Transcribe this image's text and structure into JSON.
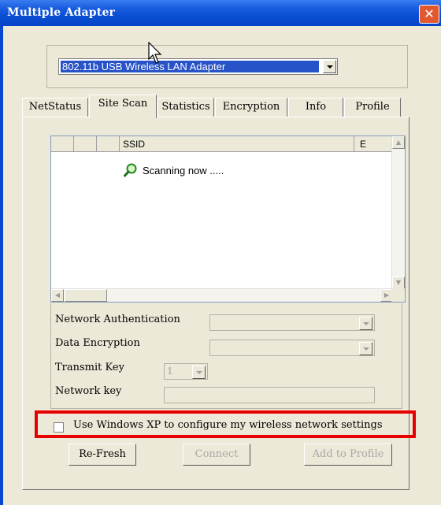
{
  "window": {
    "title": "Multiple Adapter",
    "close_glyph": "✕"
  },
  "adapter": {
    "selected": "802.11b USB Wireless LAN Adapter"
  },
  "tabs": [
    {
      "label": "NetStatus",
      "active": false
    },
    {
      "label": "Site Scan",
      "active": true
    },
    {
      "label": "Statistics",
      "active": false
    },
    {
      "label": "Encryption",
      "active": false
    },
    {
      "label": "Info",
      "active": false
    },
    {
      "label": "Profile",
      "active": false
    }
  ],
  "site_scan": {
    "columns": [
      "",
      "",
      "",
      "SSID",
      "E"
    ],
    "status": "Scanning now .....",
    "status_icon": "search-icon"
  },
  "settings": {
    "network_authentication": {
      "label": "Network Authentication",
      "value": ""
    },
    "data_encryption": {
      "label": "Data Encryption",
      "value": ""
    },
    "transmit_key": {
      "label": "Transmit Key",
      "value": "1"
    },
    "network_key": {
      "label": "Network key",
      "value": ""
    }
  },
  "xp_config": {
    "label": "Use Windows XP to configure my wireless network settings",
    "checked": false,
    "highlight_color": "#e60000"
  },
  "buttons": {
    "refresh": "Re-Fresh",
    "connect": "Connect",
    "add_to_profile": "Add to Profile"
  },
  "colors": {
    "titlebar": "#0a4fd4",
    "selection": "#2853c8",
    "dialog_bg": "#ece9d8"
  }
}
